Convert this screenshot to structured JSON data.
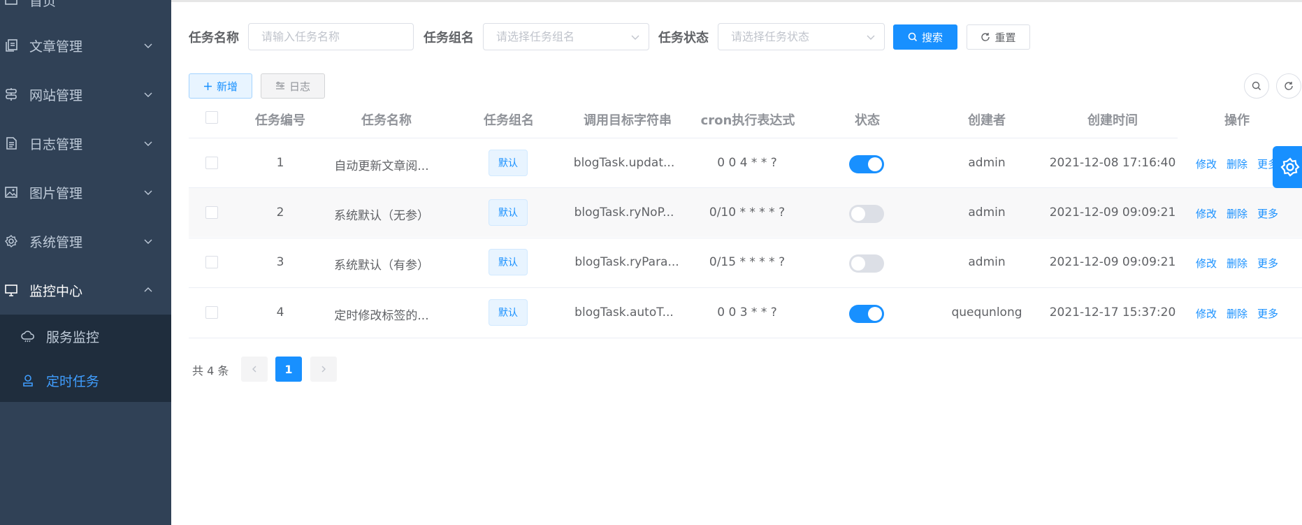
{
  "sidebar": {
    "items": [
      {
        "label": "首页",
        "icon": "dashboard-icon"
      },
      {
        "label": "文章管理",
        "icon": "document-copy-icon"
      },
      {
        "label": "网站管理",
        "icon": "signpost-icon"
      },
      {
        "label": "日志管理",
        "icon": "log-file-icon"
      },
      {
        "label": "图片管理",
        "icon": "picture-icon"
      },
      {
        "label": "系统管理",
        "icon": "gear-icon"
      },
      {
        "label": "监控中心",
        "icon": "monitor-icon"
      }
    ],
    "subitems": [
      {
        "label": "服务监控",
        "icon": "cloud-icon"
      },
      {
        "label": "定时任务",
        "icon": "user-stamp-icon",
        "active": true
      }
    ]
  },
  "filters": {
    "task_name_label": "任务名称",
    "task_name_placeholder": "请输入任务名称",
    "task_group_label": "任务组名",
    "task_group_placeholder": "请选择任务组名",
    "task_status_label": "任务状态",
    "task_status_placeholder": "请选择任务状态",
    "search_label": "搜索",
    "reset_label": "重置"
  },
  "toolbar": {
    "add_label": "新增",
    "log_label": "日志"
  },
  "table": {
    "columns": [
      "任务编号",
      "任务名称",
      "任务组名",
      "调用目标字符串",
      "cron执行表达式",
      "状态",
      "创建者",
      "创建时间",
      "操作"
    ],
    "rows": [
      {
        "id": "1",
        "name": "自动更新文章阅...",
        "group": "默认",
        "target": "blogTask.updat...",
        "cron": "0 0 4 * * ?",
        "status_on": true,
        "creator": "admin",
        "time": "2021-12-08 17:16:40"
      },
      {
        "id": "2",
        "name": "系统默认（无参）",
        "group": "默认",
        "target": "blogTask.ryNoP...",
        "cron": "0/10 * * * * ?",
        "status_on": false,
        "creator": "admin",
        "time": "2021-12-09 09:09:21"
      },
      {
        "id": "3",
        "name": "系统默认（有参）",
        "group": "默认",
        "target": "blogTask.ryPara...",
        "cron": "0/15 * * * * ?",
        "status_on": false,
        "creator": "admin",
        "time": "2021-12-09 09:09:21"
      },
      {
        "id": "4",
        "name": "定时修改标签的...",
        "group": "默认",
        "target": "blogTask.autoT...",
        "cron": "0 0 3 * * ?",
        "status_on": true,
        "creator": "quequnlong",
        "time": "2021-12-17 15:37:20"
      }
    ],
    "actions": {
      "edit": "修改",
      "delete": "删除",
      "more": "更多"
    }
  },
  "pagination": {
    "total": "共 4 条",
    "current_page": "1"
  },
  "colors": {
    "accent": "#1890ff",
    "sidebar_bg": "#304156",
    "submenu_bg": "#1f2d3d"
  }
}
